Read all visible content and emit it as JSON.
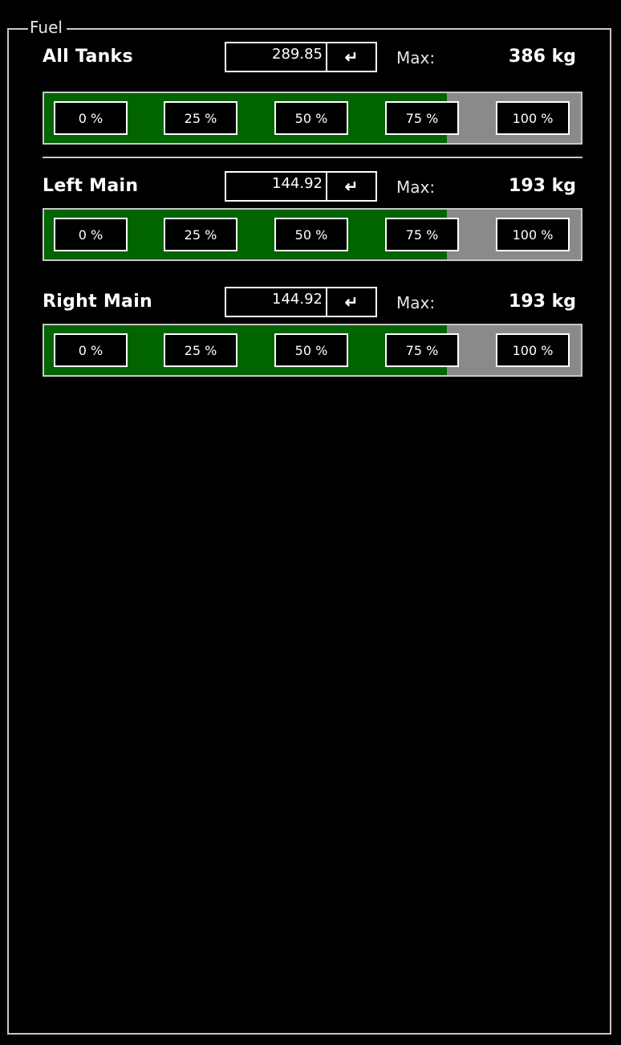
{
  "panel": {
    "title": "Fuel"
  },
  "colors": {
    "fill": "#006400",
    "empty": "#8a8a8a",
    "border": "#c8c8c8"
  },
  "enter_icon": "return-icon",
  "enter_glyph": "↵",
  "percent_buttons": [
    "0 %",
    "25 %",
    "50 %",
    "75 %",
    "100 %"
  ],
  "tanks": [
    {
      "name": "All Tanks",
      "quantity": "289.85",
      "max_label": "Max:",
      "max_value": "386 kg",
      "fill_fraction": 0.75
    },
    {
      "name": "Left Main",
      "quantity": "144.92",
      "max_label": "Max:",
      "max_value": "193 kg",
      "fill_fraction": 0.75
    },
    {
      "name": "Right Main",
      "quantity": "144.92",
      "max_label": "Max:",
      "max_value": "193 kg",
      "fill_fraction": 0.75
    }
  ]
}
